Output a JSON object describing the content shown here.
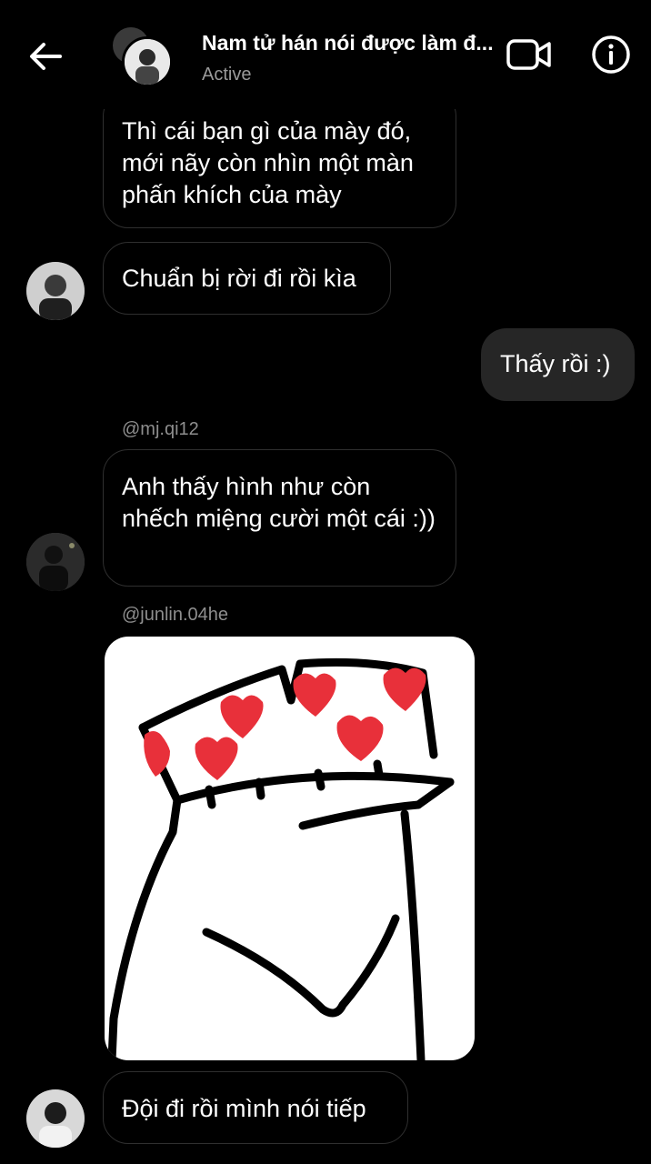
{
  "header": {
    "title": "Nam tử hán nói được làm đ...",
    "status": "Active",
    "icons": {
      "back": "arrow-left-icon",
      "video": "video-camera-icon",
      "info": "info-icon"
    }
  },
  "messages": [
    {
      "type": "incoming",
      "text": "Thì cái bạn gì của mày đó, mới nãy còn nhìn một màn phấn khích của mày"
    },
    {
      "type": "incoming",
      "text": "Chuẩn bị rời đi rồi kìa"
    },
    {
      "type": "outgoing",
      "text": "Thấy rồi :)"
    },
    {
      "type": "incoming",
      "mention": "@mj.qi12",
      "text": "Anh thấy hình như còn nhếch miệng cười một cái :))"
    },
    {
      "type": "sticker",
      "mention": "@junlin.04he",
      "description": "sticker"
    },
    {
      "type": "incoming",
      "text": "Đội đi rồi mình nói tiếp"
    }
  ],
  "colors": {
    "background": "#000000",
    "outgoing_bubble": "#262626",
    "bubble_border": "#2f2f2f",
    "muted_text": "#9a9a9a",
    "heart_red": "#e8303a"
  }
}
